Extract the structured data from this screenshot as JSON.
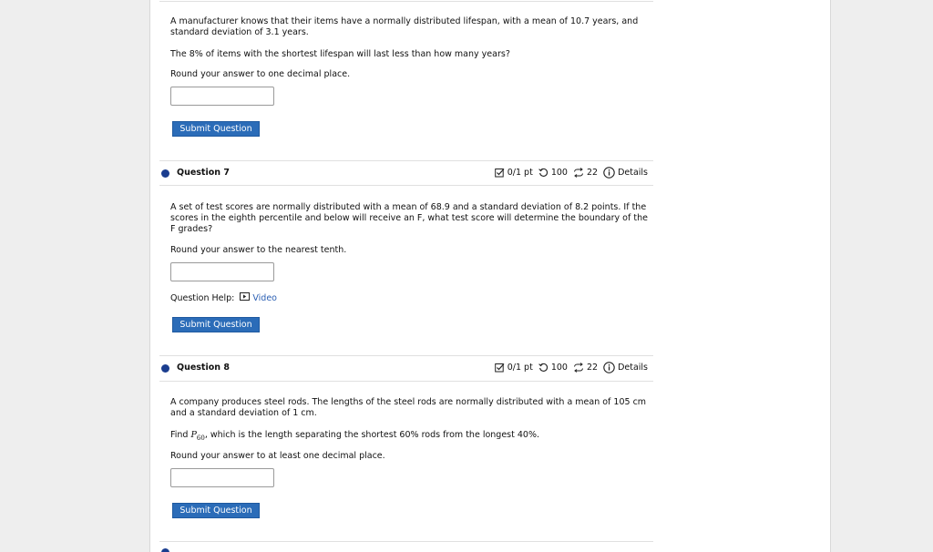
{
  "q6": {
    "text_line1": "A manufacturer knows that their items have a normally distributed lifespan, with a mean of 10.7 years, and",
    "text_line2": "standard deviation of 3.1 years.",
    "question": "The 8% of items with the shortest lifespan will last less than how many years?",
    "round": "Round your answer to one decimal place.",
    "answer": "",
    "submit": "Submit Question"
  },
  "q7": {
    "title": "Question 7",
    "score": "0/1 pt",
    "tries": "100",
    "versions": "22",
    "details": "Details",
    "text_line1": "A set of test scores are normally distributed with a mean of 68.9 and a standard deviation of 8.2 points. If the",
    "text_line2": "scores in the eighth percentile and below will receive an F, what test score will determine the boundary of the",
    "text_line3": "F grades?",
    "round": "Round your answer to the nearest tenth.",
    "answer": "",
    "help_label": "Question Help:",
    "video_label": "Video",
    "submit": "Submit Question"
  },
  "q8": {
    "title": "Question 8",
    "score": "0/1 pt",
    "tries": "100",
    "versions": "22",
    "details": "Details",
    "text_line1": "A company produces steel rods. The lengths of the steel rods are normally distributed with a mean of 105 cm",
    "text_line2": "and a standard deviation of 1 cm.",
    "find_prefix": "Find ",
    "p_symbol": "P",
    "p_sub": "60",
    "find_suffix": ", which is the length separating the shortest 60% rods from the longest 40%.",
    "round": "Round your answer to at least one decimal place.",
    "answer": "",
    "submit": "Submit Question"
  },
  "colors": {
    "accent": "#2b6cb8",
    "dot": "#1a3d8f",
    "link": "#2b5fb3"
  },
  "icons": [
    "checkbox-score-icon",
    "retry-icon",
    "versions-icon",
    "info-icon",
    "video-icon"
  ]
}
